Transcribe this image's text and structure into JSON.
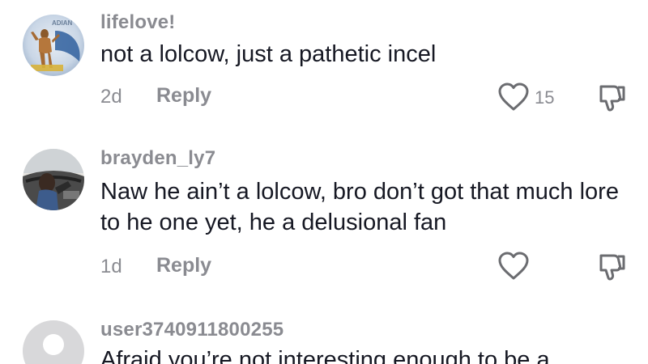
{
  "comments": [
    {
      "username": "lifelove!",
      "text": "not a lolcow, just a pathetic incel",
      "time": "2d",
      "reply_label": "Reply",
      "likes": "15",
      "avatar_badge": "ADIAN"
    },
    {
      "username": "brayden_ly7",
      "text": "Naw he ain’t a lolcow, bro don’t got that much lore to he one yet, he a delusional fan",
      "time": "1d",
      "reply_label": "Reply",
      "likes": ""
    },
    {
      "username": "user3740911800255",
      "text": "Afraid you’re not interesting enough to be a"
    }
  ],
  "icons": {
    "like": "heart-outline-icon",
    "dislike": "thumbs-down-icon",
    "default_avatar": "default-user-icon"
  },
  "colors": {
    "text_primary": "#161823",
    "text_secondary": "#8a8b91",
    "icon": "#6b6c70"
  }
}
